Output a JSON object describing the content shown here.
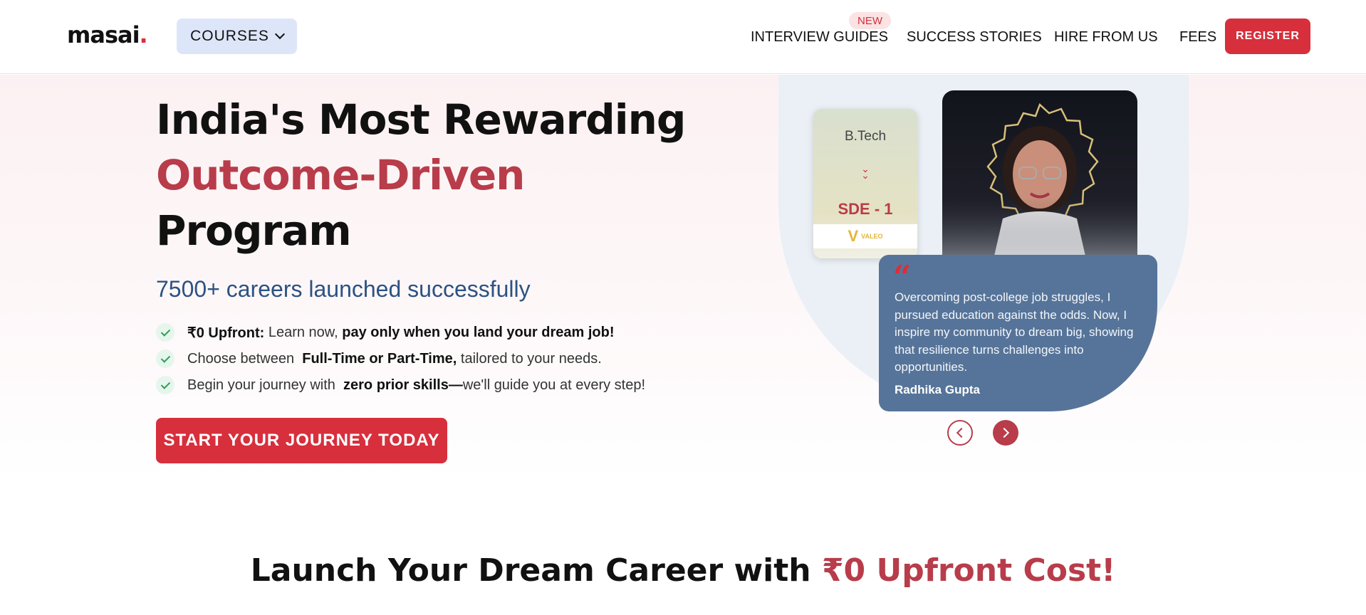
{
  "header": {
    "logo": "masai",
    "logo_dot": ".",
    "courses_label": "COURSES",
    "nav": {
      "interview_guides": "INTERVIEW GUIDES",
      "new_badge": "NEW",
      "success_stories": "SUCCESS STORIES",
      "hire_from_us": "HIRE FROM US",
      "fees": "FEES"
    },
    "register_label": "REGISTER"
  },
  "hero": {
    "title_line1": "India's Most Rewarding",
    "title_line2": "Outcome-Driven",
    "title_line3": "Program",
    "subheading": "7500+ careers launched successfully",
    "bullets": [
      {
        "strong1": "₹0 Upfront:",
        "text1": " Learn now, ",
        "strong2": "pay only when you land your dream job!",
        "text2": ""
      },
      {
        "strong1": "",
        "text1": "Choose between  ",
        "strong2": "Full-Time or Part-Time,",
        "text2": " tailored to your needs."
      },
      {
        "strong1": "",
        "text1": "Begin your journey with  ",
        "strong2": "zero prior skills—",
        "text2": "we'll guide you at every step!"
      }
    ],
    "cta_label": "START YOUR JOURNEY TODAY"
  },
  "testimonial": {
    "card_from": "B.Tech",
    "card_to": "SDE - 1",
    "card_logo": "VALEO",
    "quote_mark": "“",
    "quote": "Overcoming post-college job struggles, I pursued education against the odds. Now, I inspire my community to dream big, showing that resilience turns challenges into opportunities.",
    "name": "Radhika Gupta"
  },
  "section": {
    "heading_prefix": "Launch Your Dream Career with ",
    "heading_accent": "₹0 Upfront Cost!"
  },
  "colors": {
    "brand_red": "#d72f3c",
    "accent_maroon": "#b83c4a",
    "quote_blue": "#567499",
    "subhead_blue": "#2c5282"
  }
}
